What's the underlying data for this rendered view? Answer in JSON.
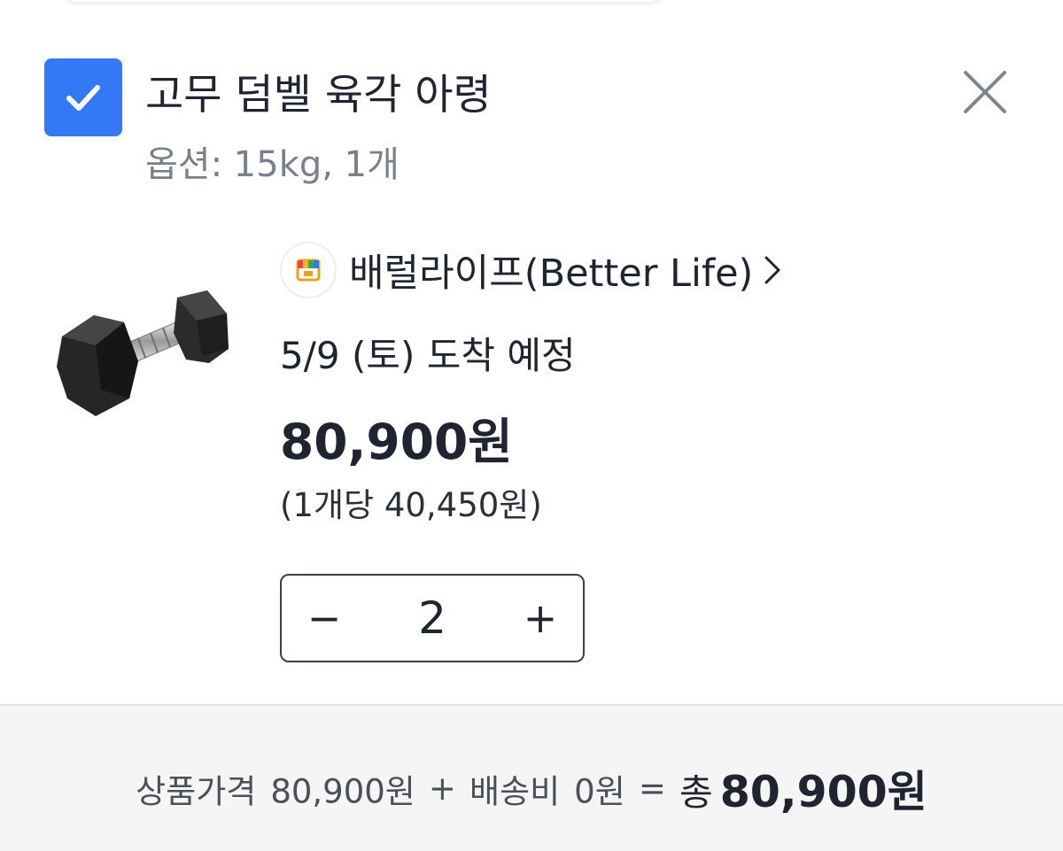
{
  "cart_item": {
    "checked": true,
    "product_name": "고무 덤벨 육각 아령",
    "option": "옵션: 15kg, 1개",
    "seller": "배럴라이프(Better Life)",
    "delivery": "5/9 (토) 도착 예정",
    "price": "80,900원",
    "unit_price": "(1개당 40,450원)",
    "quantity": "2",
    "decrement_symbol": "−",
    "increment_symbol": "+"
  },
  "summary": {
    "product_price_label": "상품가격",
    "product_price": "80,900원",
    "plus": "+",
    "shipping_label": "배송비",
    "shipping_fee": "0원",
    "equals": "=",
    "total_label": "총",
    "total": "80,900원"
  },
  "icons": {
    "checkbox": "check-icon",
    "remove": "close-icon",
    "seller_logo": "store-logo-icon",
    "seller_link": "chevron-right-icon",
    "product_image": "dumbbell-image"
  },
  "colors": {
    "accent": "#3478f6",
    "text_primary": "#1f2430",
    "text_secondary": "#7a808b",
    "summary_background": "#f5f5f6"
  }
}
